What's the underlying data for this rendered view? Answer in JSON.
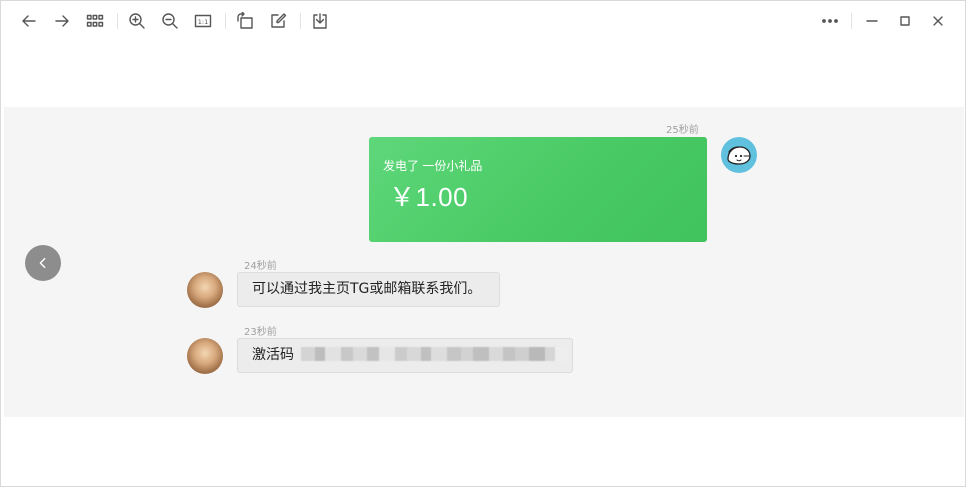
{
  "toolbar": {
    "icons": [
      "back-arrow-icon",
      "forward-arrow-icon",
      "grid-icon",
      "zoom-in-icon",
      "zoom-out-icon",
      "actual-size-icon",
      "rotate-icon",
      "edit-icon",
      "download-icon",
      "more-icon",
      "minimize-icon",
      "maximize-icon",
      "close-icon"
    ],
    "actual_size_label": "1:1"
  },
  "messages": [
    {
      "sender": "me",
      "time": "25秒前",
      "type": "gift",
      "title": "发电了 一份小礼品",
      "amount": "￥1.00"
    },
    {
      "sender": "other",
      "time": "24秒前",
      "type": "text",
      "text": "可以通过我主页TG或邮箱联系我们。"
    },
    {
      "sender": "other",
      "time": "23秒前",
      "type": "text",
      "text": "激活码",
      "redacted": true
    }
  ],
  "colors": {
    "gift_green": "#4cca66",
    "chat_background": "#f5f5f5",
    "bubble": "#ececec",
    "nav_button": "#8d8d8d"
  }
}
